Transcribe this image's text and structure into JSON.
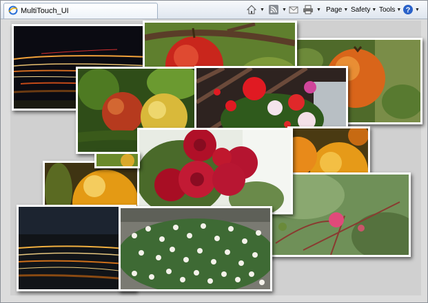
{
  "tab": {
    "title": "MultiTouch_UI",
    "icon": "ie-page-icon"
  },
  "toolbar": {
    "home_icon": "home-icon",
    "feeds_icon": "feeds-icon",
    "mail_icon": "mail-icon",
    "print_icon": "print-icon",
    "page_label": "Page",
    "safety_label": "Safety",
    "tools_label": "Tools",
    "help_icon": "help-icon"
  },
  "photos": [
    {
      "subject": "light-trails-night"
    },
    {
      "subject": "red-apple-on-branch"
    },
    {
      "subject": "orange-persimmon"
    },
    {
      "subject": "apples-on-tree"
    },
    {
      "subject": "geranium-flowers"
    },
    {
      "subject": "yellow-plum"
    },
    {
      "subject": "red-roses"
    },
    {
      "subject": "orange-fruit-cluster"
    },
    {
      "subject": "pink-rosebud"
    },
    {
      "subject": "yellow-fruit"
    },
    {
      "subject": "light-trails-dusk"
    },
    {
      "subject": "white-flower-bush"
    }
  ]
}
